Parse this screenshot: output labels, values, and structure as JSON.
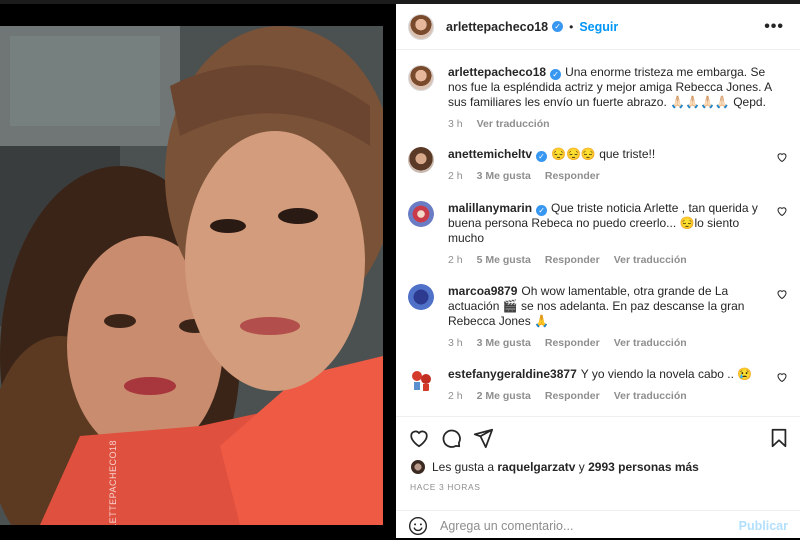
{
  "photo": {
    "watermark": "@ARLETTEPACHECO18"
  },
  "header": {
    "username": "arlettepacheco18",
    "verified_mark": "✓",
    "separator": "•",
    "follow_label": "Seguir",
    "more_label": "•••"
  },
  "comments": [
    {
      "username": "arlettepacheco18",
      "verified": true,
      "text": "Una enorme tristeza me embarga. Se nos fue la espléndida actriz y mejor amiga Rebecca Jones. A sus familiares les envío un fuerte abrazo. 🙏🏻🙏🏻🙏🏻🙏🏻 Qepd.",
      "time": "3 h",
      "likes": "",
      "reply": "",
      "translate": "Ver traducción",
      "avatar_icon": "author-avatar"
    },
    {
      "username": "anettemicheltv",
      "verified": true,
      "text": "😔😔😔 que triste!!",
      "time": "2 h",
      "likes": "3 Me gusta",
      "reply": "Responder",
      "translate": "",
      "avatar_icon": "user-avatar"
    },
    {
      "username": "malillanymarin",
      "verified": true,
      "text": "Que triste noticia Arlette , tan querida y buena persona Rebeca no puedo creerlo... 😔lo siento mucho",
      "time": "2 h",
      "likes": "5 Me gusta",
      "reply": "Responder",
      "translate": "Ver traducción",
      "avatar_icon": "user-avatar"
    },
    {
      "username": "marcoa9879",
      "verified": false,
      "text": "Oh wow lamentable, otra grande de La actuación 🎬 se nos adelanta. En paz descanse la gran Rebecca Jones 🙏",
      "time": "3 h",
      "likes": "3 Me gusta",
      "reply": "Responder",
      "translate": "Ver traducción",
      "avatar_icon": "user-avatar"
    },
    {
      "username": "estefanygeraldine3877",
      "verified": false,
      "text": "Y yo viendo la novela cabo .. 😢",
      "time": "2 h",
      "likes": "2 Me gusta",
      "reply": "Responder",
      "translate": "Ver traducción",
      "avatar_icon": "user-avatar"
    }
  ],
  "likes": {
    "prefix": "Les gusta a",
    "user": "raquelgarzatv",
    "conj": "y",
    "others": "2993 personas más"
  },
  "post_time": "HACE 3 HORAS",
  "add_comment": {
    "placeholder": "Agrega un comentario...",
    "publish_label": "Publicar"
  },
  "icons": [
    "heart-icon",
    "comment-icon",
    "share-icon",
    "bookmark-icon",
    "emoji-icon",
    "more-icon"
  ],
  "colors": {
    "accent": "#0095f6",
    "verified": "#3897f0",
    "muted": "#8e8e8e",
    "publish_disabled": "#b2dffc"
  }
}
